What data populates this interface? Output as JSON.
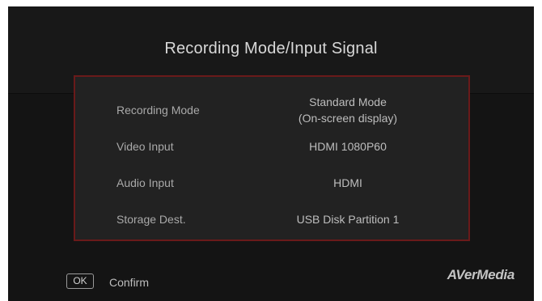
{
  "title": "Recording Mode/Input Signal",
  "rows": [
    {
      "label": "Recording Mode",
      "value_line1": "Standard Mode",
      "value_line2": "(On-screen display)"
    },
    {
      "label": "Video Input",
      "value_line1": "HDMI 1080P60"
    },
    {
      "label": "Audio Input",
      "value_line1": "HDMI"
    },
    {
      "label": "Storage Dest.",
      "value_line1": "USB Disk Partition 1"
    }
  ],
  "footer": {
    "ok_key": "OK",
    "confirm_label": "Confirm",
    "brand": "AVerMedia"
  },
  "colors": {
    "background": "#141414",
    "panel_fill": "#222222",
    "panel_border": "#6a1a1a"
  }
}
